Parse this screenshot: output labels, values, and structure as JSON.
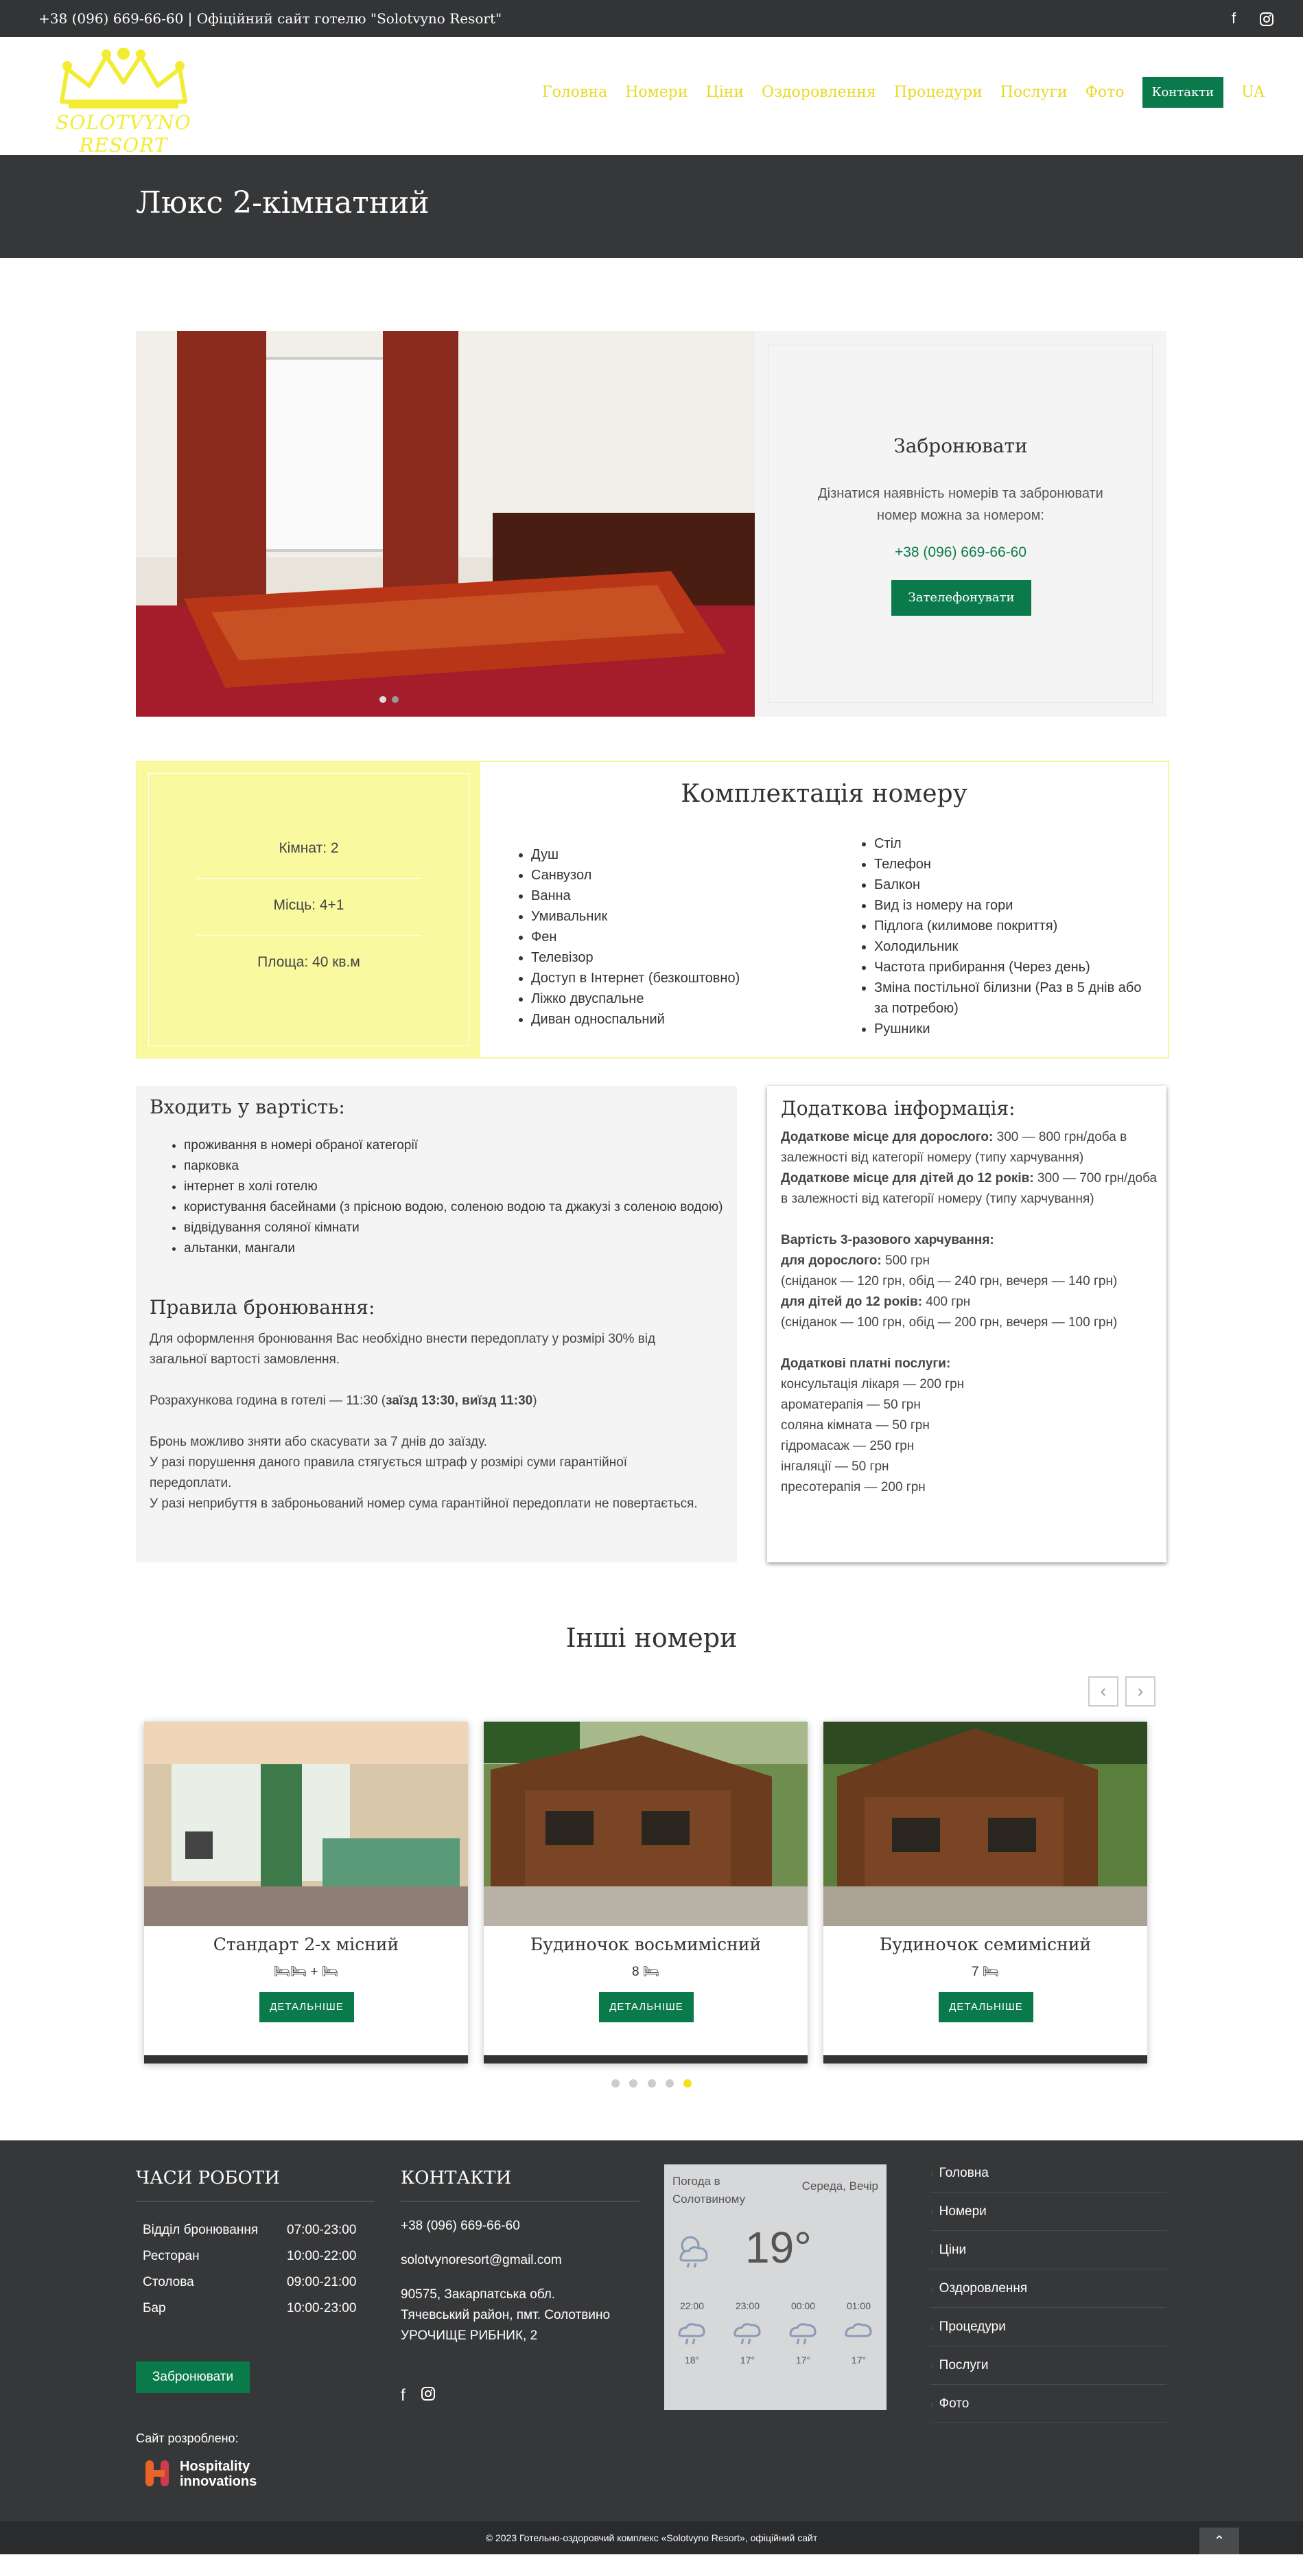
{
  "topbar": {
    "text": "+38 (096) 669-66-60 | Офіційний сайт готелю \"Solotvyno Resort\"",
    "social": [
      "facebook-icon",
      "instagram-icon"
    ]
  },
  "header": {
    "logo_text": "SOLOTVYNO RESORT",
    "nav": [
      {
        "label": "Головна"
      },
      {
        "label": "Номери"
      },
      {
        "label": "Ціни"
      },
      {
        "label": "Оздоровлення"
      },
      {
        "label": "Процедури"
      },
      {
        "label": "Послуги"
      },
      {
        "label": "Фото"
      },
      {
        "label": "Контакти",
        "active": true
      },
      {
        "label": "UA"
      }
    ]
  },
  "page_title": "Люкс 2-кімнатний",
  "booking": {
    "title": "Забронювати",
    "text": "Дізнатися наявність номерів та забронювати номер можна за номером:",
    "phone": "+38 (096) 669-66-60",
    "button": "Зателефонувати"
  },
  "equipment": {
    "title": "Комплектація номеру",
    "stats": [
      "Кімнат: 2",
      "Місць: 4+1",
      "Площа: 40 кв.м"
    ],
    "col1": [
      "Душ",
      "Санвузол",
      "Ванна",
      "Умивальник",
      "Фен",
      "Телевізор",
      "Доступ в Інтернет (безкоштовно)",
      "Ліжко двуспальне",
      "Диван односпальний"
    ],
    "col2": [
      "Стіл",
      "Телефон",
      "Балкон",
      "Вид із номеру на гори",
      "Підлога (килимове покриття)",
      "Холодильник",
      "Частота прибирання (Через день)",
      "Зміна постільної білизни (Раз в 5 днів або за потребою)",
      "Рушники"
    ]
  },
  "included": {
    "title": "Входить у вартість:",
    "items": [
      "проживання в номері обраної категорії",
      "парковка",
      "інтернет в холі готелю",
      "користування басейнами (з прісною водою, соленою водою та джакузі з соленою водою)",
      "відвідування соляної кімнати",
      "альтанки, мангали"
    ],
    "rules_title": "Правила бронювання:",
    "rules_1": "Для оформлення бронювання Вас необхідно внести передоплату у розмірі 30% від загальної вартості замовлення.",
    "rules_2a": "Розрахункова година в готелі — 11:30 (",
    "rules_2b": "заїзд 13:30, виїзд 11:30",
    "rules_2c": ")",
    "rules_3": "Бронь можливо зняти або скасувати за 7 днів до заїзду.",
    "rules_4": "У разі порушення даного правила стягується штраф у розмірі суми гарантійної передоплати.",
    "rules_5": "У разі неприбуття в заброньований номер сума гарантійної передоплати не повертається."
  },
  "additional": {
    "title": "Додаткова інформація:",
    "adult_bed_b": "Додаткове місце для дорослого:",
    "adult_bed": " 300 — 800 грн/доба в залежності від категорії номеру (типу харчування)",
    "child_bed_b": "Додаткове місце для дітей до 12 років:",
    "child_bed": " 300 — 700 грн/доба в залежності від категорії номеру (типу харчування)",
    "meals_b": "Вартість 3-разового харчування:",
    "adult_meal_b": "для дорослого:",
    "adult_meal": " 500 грн",
    "adult_meal_det": "(сніданок — 120 грн, обід — 240 грн, вечеря — 140 грн)",
    "child_meal_b": "для дітей до 12 років:",
    "child_meal": " 400 грн",
    "child_meal_det": "(сніданок — 100 грн, обід — 200 грн, вечеря — 100 грн)",
    "paid_b": "Додаткові платні послуги:",
    "paid": [
      "консультація лікаря — 200 грн",
      "ароматерапія — 50 грн",
      "соляна кімната — 50 грн",
      "гідромасаж — 250 грн",
      "інгаляції — 50 грн",
      "пресотерапія — 200 грн"
    ]
  },
  "other": {
    "title": "Інші номери",
    "cards": [
      {
        "title": "Стандарт 2-х місний",
        "caption": "+",
        "button": "ДЕТАЛЬНІШЕ"
      },
      {
        "title": "Будиночок восьмимісний",
        "caption": "8",
        "button": "ДЕТАЛЬНІШЕ"
      },
      {
        "title": "Будиночок семимісний",
        "caption": "7",
        "button": "ДЕТАЛЬНІШЕ"
      }
    ]
  },
  "footer": {
    "hours_title": "ЧАСИ РОБОТИ",
    "hours": [
      {
        "label": "Відділ бронювання",
        "time": "07:00-23:00"
      },
      {
        "label": "Ресторан",
        "time": "10:00-22:00"
      },
      {
        "label": "Столова",
        "time": "09:00-21:00"
      },
      {
        "label": "Бар",
        "time": "10:00-23:00"
      }
    ],
    "book_button": "Забронювати",
    "developed": "Сайт розроблено:",
    "dev_logo_1": "Hospitality",
    "dev_logo_2": "innovations",
    "contacts_title": "КОНТАКТИ",
    "phone": "+38 (096) 669-66-60",
    "email": "solotvynoresort@gmail.com",
    "address_1": "90575, Закарпатська обл.",
    "address_2": "Тячевський район, пмт. Солотвино",
    "address_3": "УРОЧИЩЕ РИБНИК, 2",
    "weather": {
      "location": "Погода в Солотвиному",
      "day": "Середа, Вечір",
      "temp": "19°",
      "hours": [
        {
          "time": "22:00",
          "temp": "18°"
        },
        {
          "time": "23:00",
          "temp": "17°"
        },
        {
          "time": "00:00",
          "temp": "17°"
        },
        {
          "time": "01:00",
          "temp": "17°"
        }
      ]
    },
    "links": [
      "Головна",
      "Номери",
      "Ціни",
      "Оздоровлення",
      "Процедури",
      "Послуги",
      "Фото"
    ],
    "copyright": "© 2023 Готельно-оздоровчий комплекс «Solotvyno Resort», офіційний сайт"
  },
  "colors": {
    "accent": "#0b7a4b",
    "brand_yellow": "#f2ec33",
    "dark": "#363739"
  }
}
